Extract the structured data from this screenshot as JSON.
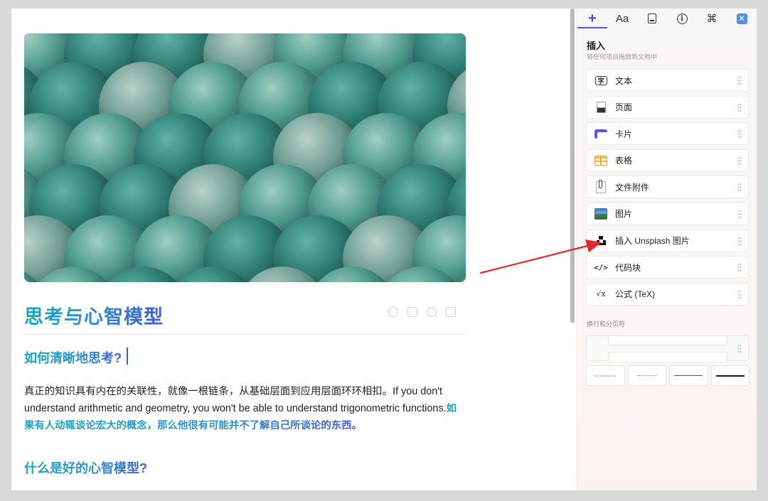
{
  "editor": {
    "title": "思考与心智模型",
    "heading1": "如何清晰地思考?",
    "paragraph_plain": "真正的知识具有内在的关联性，就像一根链条，从基础层面到应用层面环环相扣。If you don't understand arithmetic and geometry, you won't be able to understand trigonometric functions.",
    "paragraph_highlight": "如果有人动辄谈论宏大的概念，那么他很有可能并不了解自己所谈论的东西。",
    "heading2": "什么是好的心智模型?"
  },
  "panel": {
    "tabs": [
      {
        "label": "+",
        "icon": "plus-icon",
        "active": true
      },
      {
        "label": "Aa",
        "icon": "text-style-icon",
        "active": false
      },
      {
        "label": "",
        "icon": "document-icon",
        "active": false
      },
      {
        "label": "i",
        "icon": "info-icon",
        "active": false
      },
      {
        "label": "⌘",
        "icon": "command-icon",
        "active": false
      },
      {
        "label": "✕",
        "icon": "close-icon",
        "active": false
      }
    ],
    "title": "插入",
    "subtitle": "将任何项目拖放到文档中",
    "items": [
      {
        "label": "文本",
        "icon": "text-icon"
      },
      {
        "label": "页面",
        "icon": "page-icon"
      },
      {
        "label": "卡片",
        "icon": "card-icon"
      },
      {
        "label": "表格",
        "icon": "table-icon"
      },
      {
        "label": "文件附件",
        "icon": "file-attachment-icon"
      },
      {
        "label": "图片",
        "icon": "image-icon"
      },
      {
        "label": "插入 Unsplash 图片",
        "icon": "unsplash-icon"
      },
      {
        "label": "代码块",
        "icon": "code-icon"
      },
      {
        "label": "公式 (TeX)",
        "icon": "formula-icon"
      }
    ],
    "text_icon_glyph": "字",
    "code_icon_glyph": "</>",
    "formula_icon_glyph": "√x",
    "break_section_label": "换行和分页符"
  },
  "colors": {
    "accent": "#6a4bf0",
    "title_gradient_start": "#14a9bf",
    "title_gradient_end": "#3b5bd6",
    "annotation_arrow": "#e8262b"
  }
}
